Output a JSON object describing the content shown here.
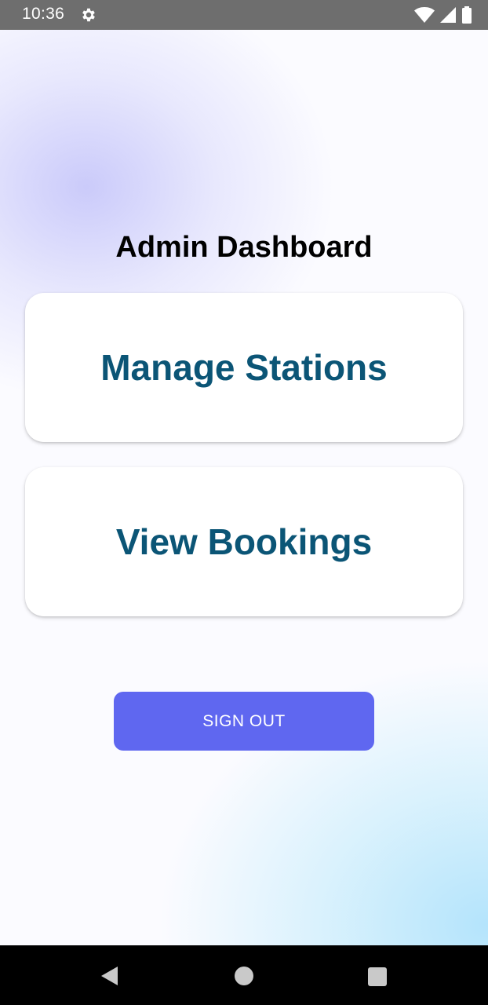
{
  "status_bar": {
    "time": "10:36",
    "icons": [
      "gear-icon",
      "wifi-icon",
      "signal-icon",
      "battery-icon"
    ]
  },
  "main": {
    "title": "Admin Dashboard",
    "cards": [
      {
        "label": "Manage Stations"
      },
      {
        "label": "View Bookings"
      }
    ],
    "sign_out_label": "SIGN OUT"
  },
  "colors": {
    "card_text": "#0b5576",
    "button": "#5f67f0",
    "status_bar": "#6e6e6e",
    "nav_bar": "#000000"
  },
  "nav_bar": {
    "icons": [
      "back-icon",
      "home-icon",
      "recents-icon"
    ]
  }
}
